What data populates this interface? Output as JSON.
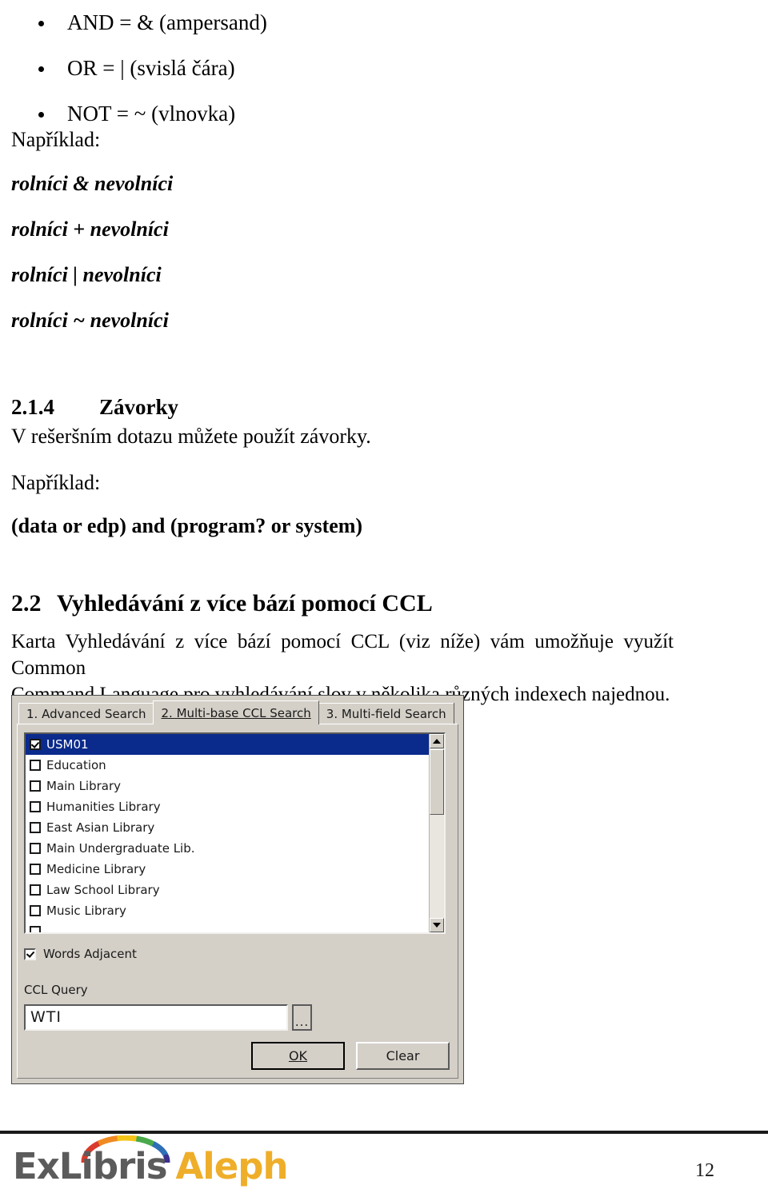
{
  "document": {
    "page_number": "12",
    "operator_bullets": [
      "AND = & (ampersand)",
      "OR = | (svislá čára)",
      "NOT = ~ (vlnovka)"
    ],
    "example_label_1": "Například:",
    "query_examples": [
      "rolníci & nevolníci",
      "rolníci + nevolníci",
      "rolníci | nevolníci",
      "rolníci ~ nevolníci"
    ],
    "section_214": {
      "number": "2.1.4",
      "title": "Závorky",
      "intro": "V rešeršním dotazu můžete použít závorky.",
      "example_label": "Například:",
      "example_query": "(data or edp) and (program? or system)"
    },
    "section_22": {
      "number": "2.2",
      "title": "Vyhledávání z více bází pomocí CCL",
      "body_line_1": "Karta Vyhledávání z více bází pomocí CCL (viz níže) vám umožňuje využít Common",
      "body_line_2": "Command Language pro vyhledávání slov v několika různých indexech najednou."
    }
  },
  "dialog": {
    "tabs": [
      {
        "label": "1. Advanced Search",
        "active": false
      },
      {
        "label": "2. Multi-base CCL Search",
        "active": true
      },
      {
        "label": "3. Multi-field Search",
        "active": false
      }
    ],
    "base_list": [
      {
        "label": "USM01",
        "checked": true,
        "selected": true
      },
      {
        "label": "Education",
        "checked": false,
        "selected": false
      },
      {
        "label": "Main Library",
        "checked": false,
        "selected": false
      },
      {
        "label": "Humanities Library",
        "checked": false,
        "selected": false
      },
      {
        "label": "East Asian Library",
        "checked": false,
        "selected": false
      },
      {
        "label": "Main Undergraduate Lib.",
        "checked": false,
        "selected": false
      },
      {
        "label": "Medicine Library",
        "checked": false,
        "selected": false
      },
      {
        "label": "Law School Library",
        "checked": false,
        "selected": false
      },
      {
        "label": "Music Library",
        "checked": false,
        "selected": false
      }
    ],
    "words_adjacent": {
      "label": "Words Adjacent",
      "checked": true
    },
    "ccl_query": {
      "label": "CCL Query",
      "value": "WTI",
      "browse_label": "..."
    },
    "buttons": {
      "ok": "OK",
      "clear": "Clear"
    },
    "colors": {
      "face": "#d4d0c8",
      "selection": "#0a2a8c",
      "field": "#ffffff"
    }
  },
  "footer": {
    "logo_ex": "ExLibris",
    "logo_product": "Aleph",
    "logo_colors": {
      "wordmark": "#5b5b5b",
      "product": "#efae2a",
      "arc": [
        "#d93a2b",
        "#f08a22",
        "#f5c518",
        "#4aa94a",
        "#2f6fb5",
        "#3b2f8f"
      ]
    }
  }
}
